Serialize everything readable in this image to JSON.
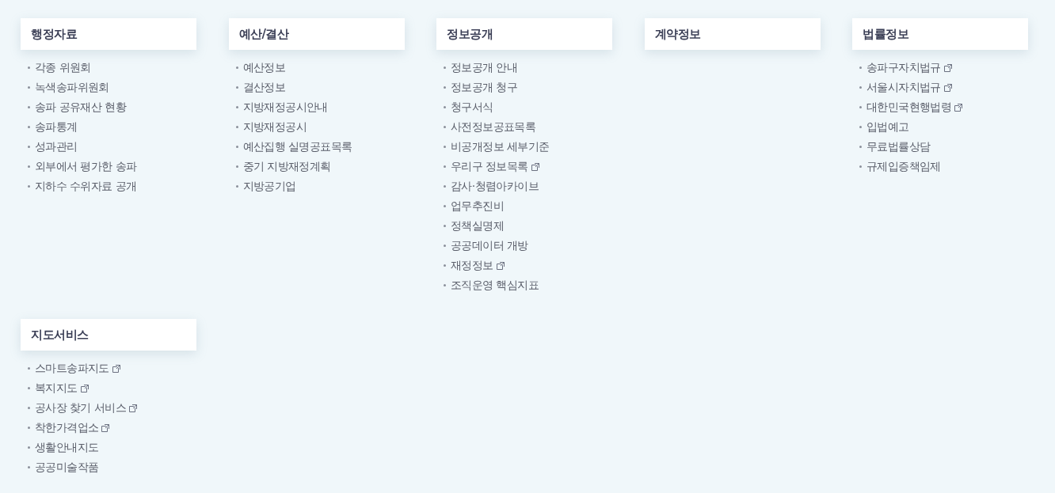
{
  "sections": [
    {
      "title": "행정자료",
      "items": [
        {
          "label": "각종 위원회",
          "external": false
        },
        {
          "label": "녹색송파위원회",
          "external": false
        },
        {
          "label": "송파 공유재산 현황",
          "external": false
        },
        {
          "label": "송파통계",
          "external": false
        },
        {
          "label": "성과관리",
          "external": false
        },
        {
          "label": "외부에서 평가한 송파",
          "external": false
        },
        {
          "label": "지하수 수위자료 공개",
          "external": false
        }
      ]
    },
    {
      "title": "예산/결산",
      "items": [
        {
          "label": "예산정보",
          "external": false
        },
        {
          "label": "결산정보",
          "external": false
        },
        {
          "label": "지방재정공시안내",
          "external": false
        },
        {
          "label": "지방재정공시",
          "external": false
        },
        {
          "label": "예산집행 실명공표목록",
          "external": false
        },
        {
          "label": "중기 지방재정계획",
          "external": false
        },
        {
          "label": "지방공기업",
          "external": false
        }
      ]
    },
    {
      "title": "정보공개",
      "items": [
        {
          "label": "정보공개 안내",
          "external": false
        },
        {
          "label": "정보공개 청구",
          "external": false
        },
        {
          "label": "청구서식",
          "external": false
        },
        {
          "label": "사전정보공표목록",
          "external": false
        },
        {
          "label": "비공개정보 세부기준",
          "external": false
        },
        {
          "label": "우리구 정보목록",
          "external": true
        },
        {
          "label": "감사·청렴아카이브",
          "external": false
        },
        {
          "label": "업무추진비",
          "external": false
        },
        {
          "label": "정책실명제",
          "external": false
        },
        {
          "label": "공공데이터 개방",
          "external": false
        },
        {
          "label": "재정정보",
          "external": true
        },
        {
          "label": "조직운영 핵심지표",
          "external": false
        }
      ]
    },
    {
      "title": "계약정보"
    },
    {
      "title": "법률정보",
      "items": [
        {
          "label": "송파구자치법규",
          "external": true
        },
        {
          "label": "서울시자치법규",
          "external": true
        },
        {
          "label": "대한민국현행법령",
          "external": true
        },
        {
          "label": "입법예고",
          "external": false
        },
        {
          "label": "무료법률상담",
          "external": false
        },
        {
          "label": "규제입증책임제",
          "external": false
        }
      ]
    },
    {
      "title": "지도서비스",
      "items": [
        {
          "label": "스마트송파지도",
          "external": true
        },
        {
          "label": "복지지도",
          "external": true
        },
        {
          "label": "공사장 찾기 서비스",
          "external": true
        },
        {
          "label": "착한가격업소",
          "external": true
        },
        {
          "label": "생활안내지도",
          "external": false
        },
        {
          "label": "공공미술작품",
          "external": false
        }
      ]
    }
  ]
}
